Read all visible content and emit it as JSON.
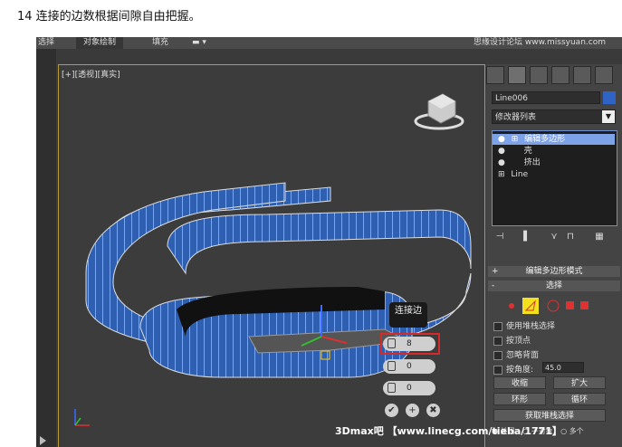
{
  "caption": "14 连接的边数根据间隙自由把握。",
  "menubar": {
    "items": [
      "选择",
      "对象绘制",
      "填充"
    ],
    "watermark": "思缘设计论坛 www.missyuan.com"
  },
  "viewport": {
    "label": "[+][透视][真实]"
  },
  "panel": {
    "object_name": "Line006",
    "object_color": "#2f63c6",
    "modifier_list": "修改器列表",
    "stack": [
      "编辑多边形",
      "壳",
      "挤出",
      "Line"
    ],
    "rollout_edit_mode": "编辑多边形模式",
    "rollout_select": "选择",
    "checkboxes": [
      "使用堆栈选择",
      "按顶点",
      "忽略背面",
      "按角度:"
    ],
    "angle_value": "45.0",
    "btn_shrink": "收缩",
    "btn_grow": "扩大",
    "btn_ring": "环形",
    "btn_loop": "循环",
    "btn_get_stack": "获取堆栈选择",
    "radio_labels": [
      "关闭",
      "子对象",
      "多个"
    ]
  },
  "popup": {
    "title": "连接边",
    "segments": "8",
    "pinch": "0",
    "slide": "0",
    "ok": "✔",
    "apply": "+",
    "cancel": "✖"
  },
  "watermark_bottom": "3Dmax吧 【www.linecg.com/tieba/1771】"
}
